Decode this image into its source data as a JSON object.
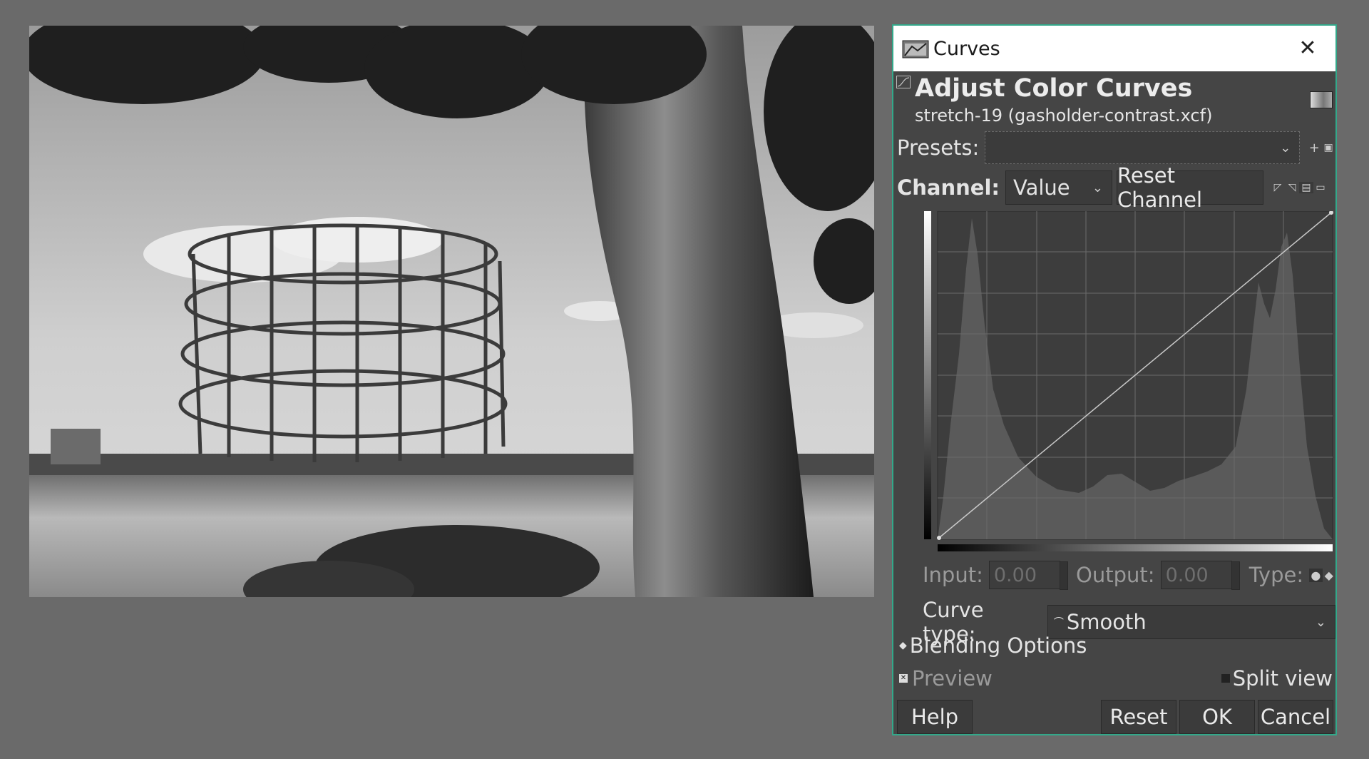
{
  "dialog": {
    "window_title": "Curves",
    "icon_name": "curves-app-icon",
    "heading": "Adjust Color Curves",
    "subheading": "stretch-19 (gasholder-contrast.xcf)",
    "presets_label": "Presets:",
    "presets_value": "",
    "channel_label": "Channel:",
    "channel_value": "Value",
    "reset_channel_label": "Reset Channel",
    "input_label": "Input:",
    "input_value": "0.00",
    "output_label": "Output:",
    "output_value": "0.00",
    "type_label": "Type:",
    "curve_type_label": "Curve type:",
    "curve_type_value": "Smooth",
    "blending_options_label": "Blending Options",
    "preview_label": "Preview",
    "split_view_label": "Split view",
    "help_label": "Help",
    "reset_label": "Reset",
    "ok_label": "OK",
    "cancel_label": "Cancel"
  },
  "colors": {
    "accent_border": "#33a88a",
    "dialog_bg": "#454545",
    "workspace_bg": "#6a6a6a"
  }
}
